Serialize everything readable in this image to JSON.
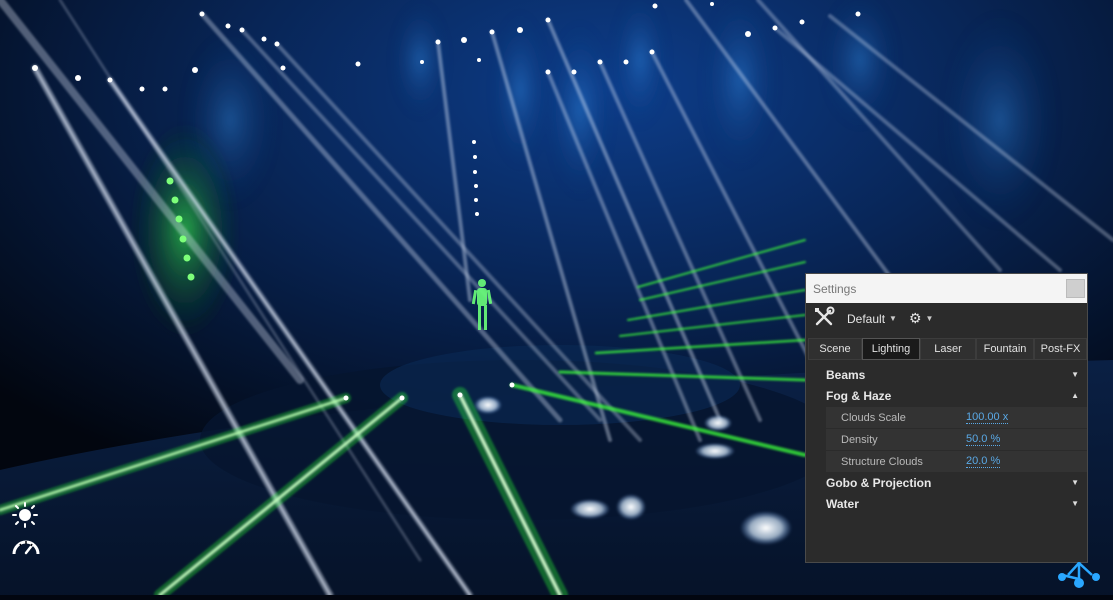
{
  "settings": {
    "title": "Settings",
    "preset": "Default",
    "tabs": [
      {
        "label": "Scene",
        "active": false
      },
      {
        "label": "Lighting",
        "active": true
      },
      {
        "label": "Laser",
        "active": false
      },
      {
        "label": "Fountain",
        "active": false
      },
      {
        "label": "Post-FX",
        "active": false
      }
    ],
    "sections": [
      {
        "label": "Beams",
        "expanded": false
      },
      {
        "label": "Fog & Haze",
        "expanded": true
      },
      {
        "label": "Gobo & Projection",
        "expanded": false
      },
      {
        "label": "Water",
        "expanded": false
      }
    ],
    "fog_properties": [
      {
        "label": "Clouds Scale",
        "value": "100.00 x"
      },
      {
        "label": "Density",
        "value": "50.0 %"
      },
      {
        "label": "Structure Clouds",
        "value": "20.0 %"
      }
    ]
  },
  "hud": {
    "icons": [
      "sun-icon",
      "speedometer-icon"
    ]
  },
  "colors": {
    "beam_white": "#e8f0ff",
    "beam_green": "#3dff3a",
    "beam_blue": "#2a78ff",
    "panel_bg": "#2b2b2b",
    "value_link": "#5aa9e6"
  }
}
